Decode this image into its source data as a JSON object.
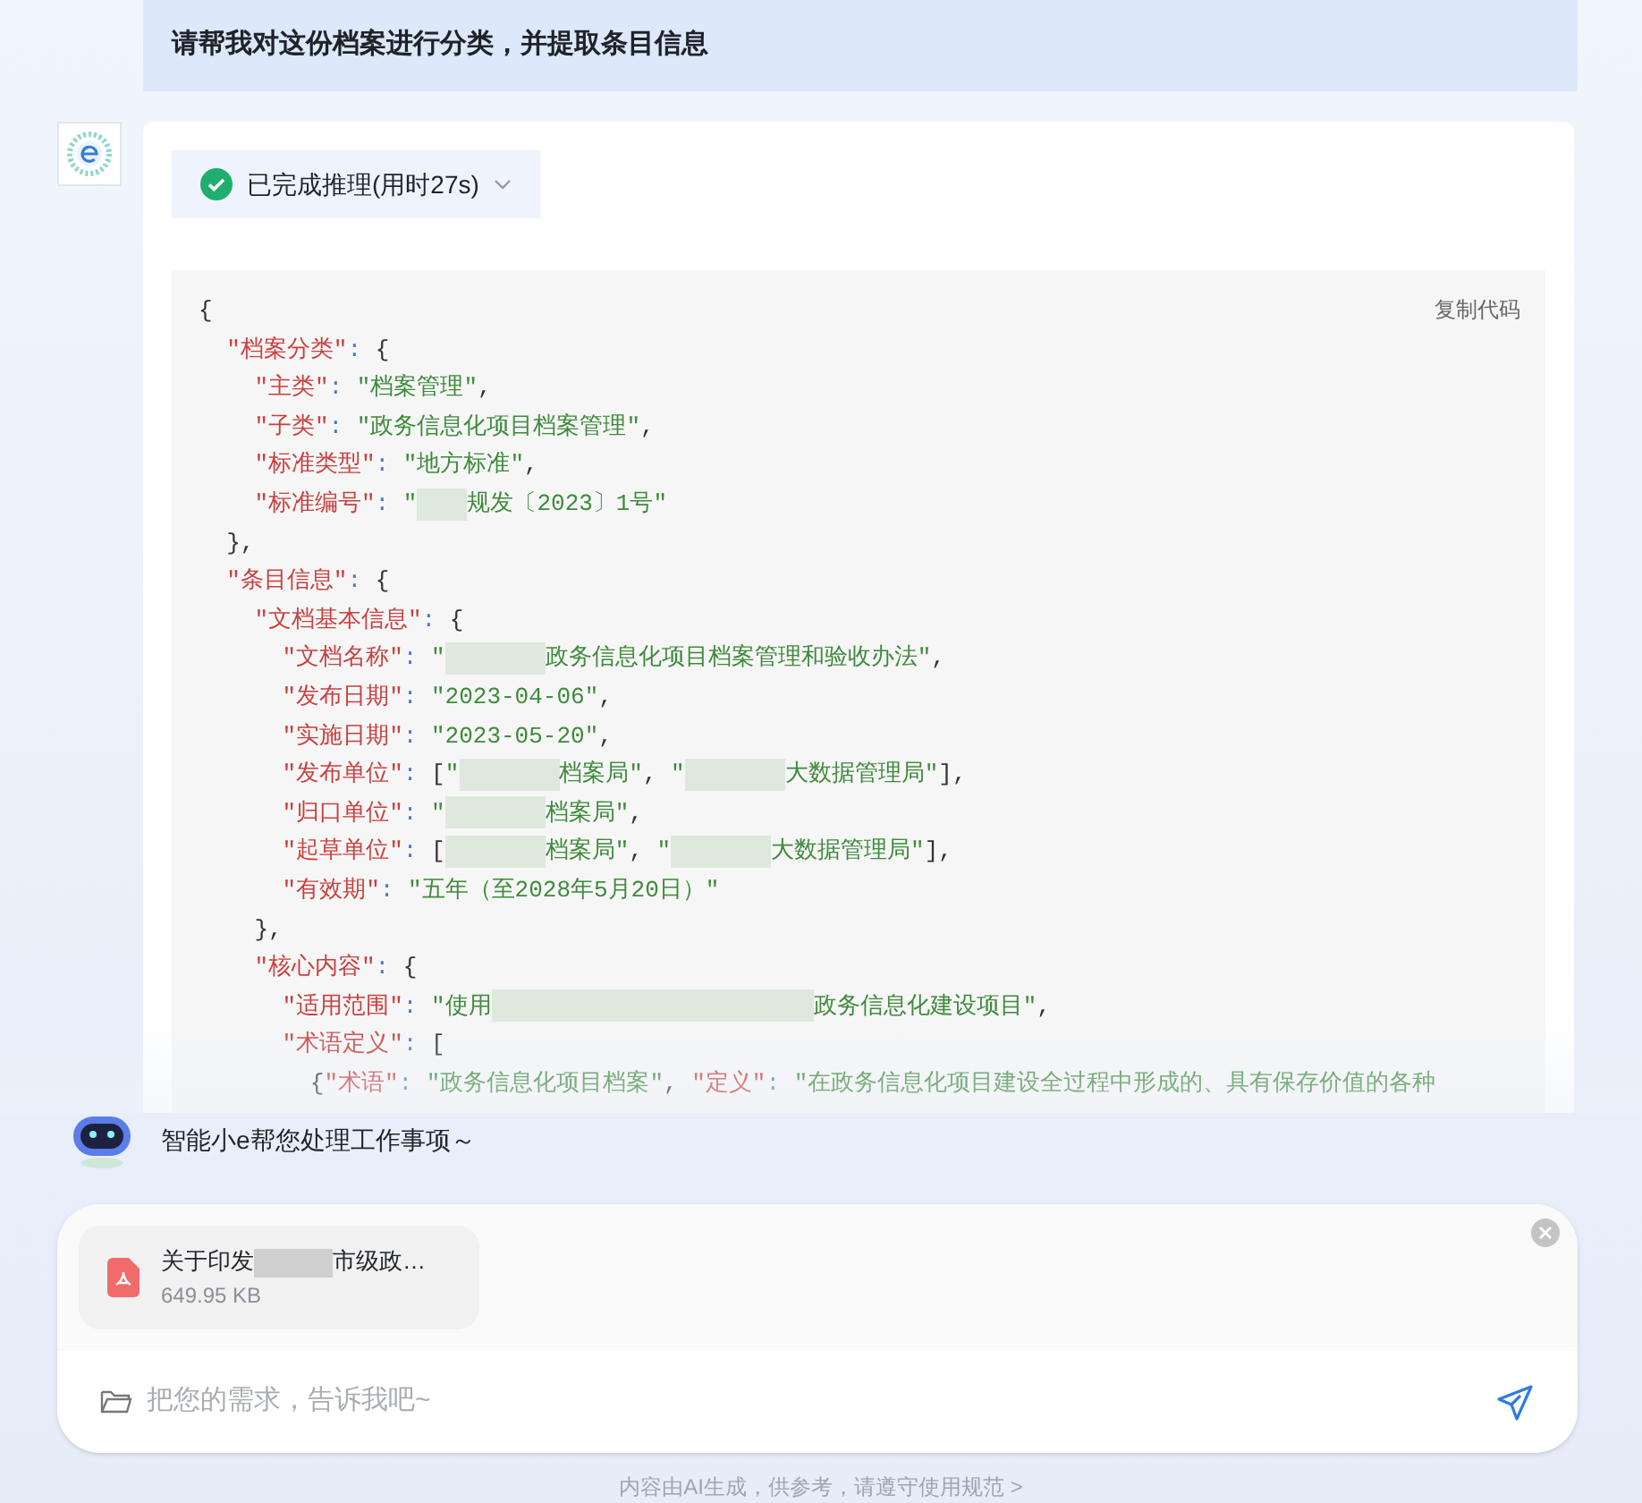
{
  "user_message": "请帮我对这份档案进行分类，并提取条目信息",
  "reasoning_status": {
    "label": "已完成推理(用时27s)",
    "done": true,
    "expanded": false
  },
  "code_block": {
    "copy_label": "复制代码",
    "lines": [
      {
        "tokens": [
          {
            "kind": "punct",
            "text": "{"
          }
        ],
        "children": [
          {
            "tokens": [
              {
                "kind": "key",
                "text": "\"档案分类\""
              },
              {
                "kind": "op",
                "text": ":"
              },
              {
                "kind": "punct",
                "text": "{"
              }
            ],
            "children": [
              {
                "tokens": [
                  {
                    "kind": "key",
                    "text": "\"主类\""
                  },
                  {
                    "kind": "op",
                    "text": ":"
                  },
                  {
                    "kind": "string",
                    "text": "\"档案管理\""
                  },
                  {
                    "kind": "punct",
                    "text": ","
                  }
                ]
              },
              {
                "tokens": [
                  {
                    "kind": "key",
                    "text": "\"子类\""
                  },
                  {
                    "kind": "op",
                    "text": ":"
                  },
                  {
                    "kind": "string",
                    "text": "\"政务信息化项目档案管理\""
                  },
                  {
                    "kind": "punct",
                    "text": ","
                  }
                ]
              },
              {
                "tokens": [
                  {
                    "kind": "key",
                    "text": "\"标准类型\""
                  },
                  {
                    "kind": "op",
                    "text": ":"
                  },
                  {
                    "kind": "string",
                    "text": "\"地方标准\""
                  },
                  {
                    "kind": "punct",
                    "text": ","
                  }
                ]
              },
              {
                "tokens": [
                  {
                    "kind": "key",
                    "text": "\"标准编号\""
                  },
                  {
                    "kind": "op",
                    "text": ":"
                  },
                  {
                    "kind": "string",
                    "text": "\""
                  },
                  {
                    "kind": "redact_short"
                  },
                  {
                    "kind": "string",
                    "text": "规发〔2023〕1号\""
                  }
                ]
              }
            ]
          },
          {
            "tokens": [
              {
                "kind": "punct",
                "text": "},"
              }
            ]
          },
          {
            "tokens": [
              {
                "kind": "key",
                "text": "\"条目信息\""
              },
              {
                "kind": "op",
                "text": ":"
              },
              {
                "kind": "punct",
                "text": "{"
              }
            ],
            "children": [
              {
                "tokens": [
                  {
                    "kind": "key",
                    "text": "\"文档基本信息\""
                  },
                  {
                    "kind": "op",
                    "text": ":"
                  },
                  {
                    "kind": "punct",
                    "text": "{"
                  }
                ],
                "children": [
                  {
                    "tokens": [
                      {
                        "kind": "key",
                        "text": "\"文档名称\""
                      },
                      {
                        "kind": "op",
                        "text": ":"
                      },
                      {
                        "kind": "string",
                        "text": "\""
                      },
                      {
                        "kind": "redact_medium"
                      },
                      {
                        "kind": "string",
                        "text": "政务信息化项目档案管理和验收办法\""
                      },
                      {
                        "kind": "punct",
                        "text": ","
                      }
                    ]
                  },
                  {
                    "tokens": [
                      {
                        "kind": "key",
                        "text": "\"发布日期\""
                      },
                      {
                        "kind": "op",
                        "text": ":"
                      },
                      {
                        "kind": "string",
                        "text": "\"2023-04-06\""
                      },
                      {
                        "kind": "punct",
                        "text": ","
                      }
                    ]
                  },
                  {
                    "tokens": [
                      {
                        "kind": "key",
                        "text": "\"实施日期\""
                      },
                      {
                        "kind": "op",
                        "text": ":"
                      },
                      {
                        "kind": "string",
                        "text": "\"2023-05-20\""
                      },
                      {
                        "kind": "punct",
                        "text": ","
                      }
                    ]
                  },
                  {
                    "tokens": [
                      {
                        "kind": "key",
                        "text": "\"发布单位\""
                      },
                      {
                        "kind": "op",
                        "text": ":"
                      },
                      {
                        "kind": "punct",
                        "text": "["
                      },
                      {
                        "kind": "string",
                        "text": "\""
                      },
                      {
                        "kind": "redact_medium"
                      },
                      {
                        "kind": "string",
                        "text": "档案局\""
                      },
                      {
                        "kind": "sep",
                        "text": ","
                      },
                      {
                        "kind": "string",
                        "text": "\""
                      },
                      {
                        "kind": "redact_medium"
                      },
                      {
                        "kind": "string",
                        "text": "大数据管理局\""
                      },
                      {
                        "kind": "punct",
                        "text": "],"
                      }
                    ]
                  },
                  {
                    "tokens": [
                      {
                        "kind": "key",
                        "text": "\"归口单位\""
                      },
                      {
                        "kind": "op",
                        "text": ":"
                      },
                      {
                        "kind": "string",
                        "text": "\""
                      },
                      {
                        "kind": "redact_medium"
                      },
                      {
                        "kind": "string",
                        "text": "档案局\""
                      },
                      {
                        "kind": "punct",
                        "text": ","
                      }
                    ]
                  },
                  {
                    "tokens": [
                      {
                        "kind": "key",
                        "text": "\"起草单位\""
                      },
                      {
                        "kind": "op",
                        "text": ":"
                      },
                      {
                        "kind": "punct",
                        "text": "["
                      },
                      {
                        "kind": "redact_medium"
                      },
                      {
                        "kind": "string",
                        "text": "档案局\""
                      },
                      {
                        "kind": "sep",
                        "text": ","
                      },
                      {
                        "kind": "string",
                        "text": "\""
                      },
                      {
                        "kind": "redact_medium"
                      },
                      {
                        "kind": "string",
                        "text": "大数据管理局\""
                      },
                      {
                        "kind": "punct",
                        "text": "],"
                      }
                    ]
                  },
                  {
                    "tokens": [
                      {
                        "kind": "key",
                        "text": "\"有效期\""
                      },
                      {
                        "kind": "op",
                        "text": ":"
                      },
                      {
                        "kind": "string",
                        "text": "\"五年（至2028年5月20日）\""
                      }
                    ]
                  }
                ]
              },
              {
                "tokens": [
                  {
                    "kind": "punct",
                    "text": "},"
                  }
                ]
              },
              {
                "tokens": [
                  {
                    "kind": "key",
                    "text": "\"核心内容\""
                  },
                  {
                    "kind": "op",
                    "text": ":"
                  },
                  {
                    "kind": "punct",
                    "text": "{"
                  }
                ],
                "children": [
                  {
                    "tokens": [
                      {
                        "kind": "key",
                        "text": "\"适用范围\""
                      },
                      {
                        "kind": "op",
                        "text": ":"
                      },
                      {
                        "kind": "string",
                        "text": "\"使用"
                      },
                      {
                        "kind": "redact_long"
                      },
                      {
                        "kind": "string",
                        "text": "政务信息化建设项目\""
                      },
                      {
                        "kind": "punct",
                        "text": ","
                      }
                    ]
                  },
                  {
                    "tokens": [
                      {
                        "kind": "key",
                        "text": "\"术语定义\""
                      },
                      {
                        "kind": "op",
                        "text": ":"
                      },
                      {
                        "kind": "punct",
                        "text": "["
                      }
                    ],
                    "children": [
                      {
                        "tokens": [
                          {
                            "kind": "punct",
                            "text": "{"
                          },
                          {
                            "kind": "key",
                            "text": "\"术语\""
                          },
                          {
                            "kind": "op",
                            "text": ":"
                          },
                          {
                            "kind": "string",
                            "text": "\"政务信息化项目档案\""
                          },
                          {
                            "kind": "sep",
                            "text": ","
                          },
                          {
                            "kind": "key",
                            "text": "\"定义\""
                          },
                          {
                            "kind": "op",
                            "text": ":"
                          },
                          {
                            "kind": "string",
                            "text": "\"在政务信息化项目建设全过程中形成的、具有保存价值的各种"
                          }
                        ]
                      }
                    ]
                  }
                ]
              }
            ]
          }
        ]
      }
    ]
  },
  "assistant_hint": "智能小e帮您处理工作事项～",
  "attachment": {
    "name": [
      {
        "kind": "text",
        "text": "关于印发"
      },
      {
        "kind": "redact"
      },
      {
        "kind": "text",
        "text": "市级政…"
      }
    ],
    "size": "649.95 KB"
  },
  "input": {
    "placeholder": "把您的需求，告诉我吧~"
  },
  "footer": "内容由AI生成，供参考，请遵守使用规范 >"
}
